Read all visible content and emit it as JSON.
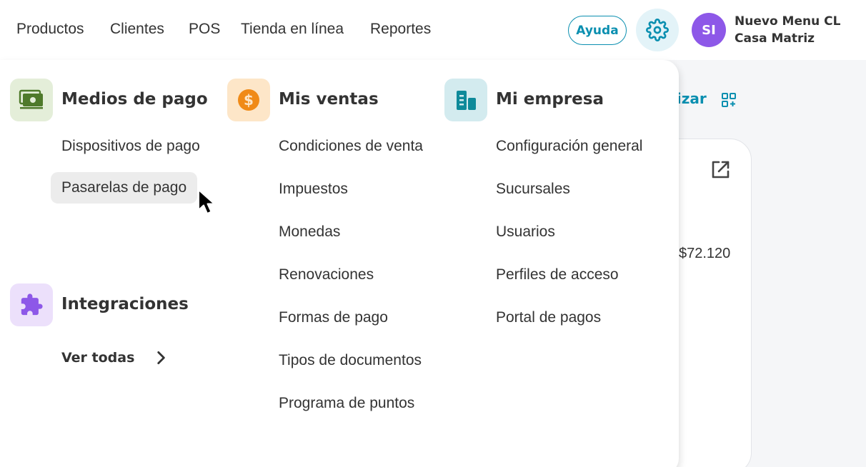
{
  "topnav": {
    "items": [
      "Productos",
      "Clientes",
      "POS",
      "Tienda en línea",
      "Reportes"
    ],
    "help_label": "Ayuda",
    "settings_icon": "gear-icon",
    "avatar_initials": "SI",
    "account_name": "Nuevo Menu CL",
    "branch_name": "Casa Matriz"
  },
  "background": {
    "link_fragment": "lizar",
    "amount": "$72.120"
  },
  "menu": {
    "payment_methods": {
      "title": "Medios de pago",
      "icon": "money-icon",
      "items": [
        "Dispositivos de pago",
        "Pasarelas de pago"
      ],
      "hovered_index": 1
    },
    "integrations": {
      "title": "Integraciones",
      "icon": "puzzle-icon",
      "view_all": "Ver todas"
    },
    "my_sales": {
      "title": "Mis ventas",
      "icon": "dollar-coin-icon",
      "items": [
        "Condiciones de venta",
        "Impuestos",
        "Monedas",
        "Renovaciones",
        "Formas de pago",
        "Tipos de documentos",
        "Programa de puntos"
      ]
    },
    "my_company": {
      "title": "Mi empresa",
      "icon": "building-icon",
      "items": [
        "Configuración general",
        "Sucursales",
        "Usuarios",
        "Perfiles de acceso",
        "Portal de pagos"
      ]
    }
  },
  "colors": {
    "accent": "#0a8fb0",
    "avatar": "#8d58e8",
    "payment_icon_bg": "#e4eed9",
    "payment_icon": "#4f7a2b",
    "sales_icon_bg": "#fde6c8",
    "sales_icon": "#f08a17",
    "company_icon_bg": "#d3ebef",
    "company_icon": "#0e8a9a",
    "integrations_icon_bg": "#ece0fb",
    "integrations_icon": "#8d58e8"
  }
}
